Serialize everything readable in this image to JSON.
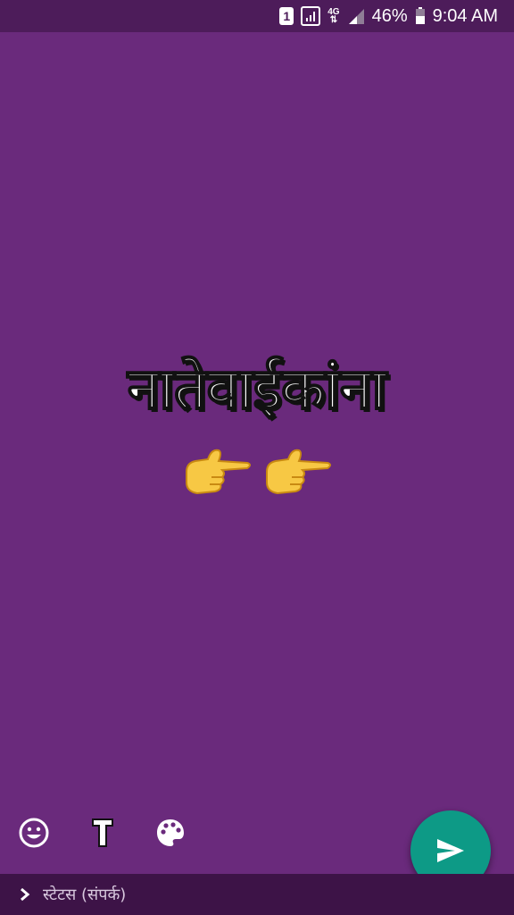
{
  "status_bar": {
    "sim_slot": "1",
    "network_type": "4G",
    "battery_percent": "46%",
    "time": "9:04 AM",
    "background_color": "#4d1c5a"
  },
  "editor": {
    "background_color": "#6a2a7c",
    "status_text": "नातेवाईकांना",
    "emojis": [
      "backhand-index-pointing-right",
      "backhand-index-pointing-right"
    ]
  },
  "toolbar": {
    "tools": [
      "emoji-icon",
      "text-style-icon",
      "palette-icon"
    ],
    "send_button_color": "#0d9a86"
  },
  "bottom_bar": {
    "audience_label": "स्टेटस (संपर्क)",
    "icon": "chevron-right-icon"
  }
}
